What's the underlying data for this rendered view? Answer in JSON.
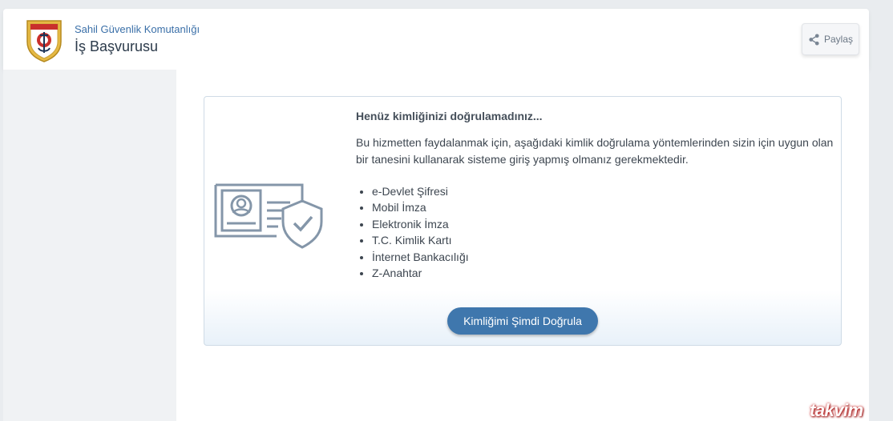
{
  "header": {
    "org_name": "Sahil Güvenlik Komutanlığı",
    "title": "İş Başvurusu",
    "share_label": "Paylaş",
    "share_icon": "share-icon",
    "logo_icon": "coast-guard-emblem"
  },
  "card": {
    "illustration_icon": "id-card-shield-icon",
    "heading": "Henüz kimliğinizi doğrulamadınız...",
    "description_line1": "Bu hizmetten faydalanmak için, aşağıdaki kimlik doğrulama yöntemlerinden sizin için uygun olan",
    "description_line2": "bir tanesini kullanarak sisteme giriş yapmış olmanız gerekmektedir.",
    "methods": [
      "e-Devlet Şifresi",
      "Mobil İmza",
      "Elektronik İmza",
      "T.C. Kimlik Kartı",
      "İnternet Bankacılığı",
      "Z-Anahtar"
    ],
    "verify_button": "Kimliğimi Şimdi Doğrula"
  },
  "watermark": "takvim",
  "colors": {
    "accent": "#3f77ad",
    "org_name": "#3a6fa8",
    "illustration": "#8496a9"
  }
}
